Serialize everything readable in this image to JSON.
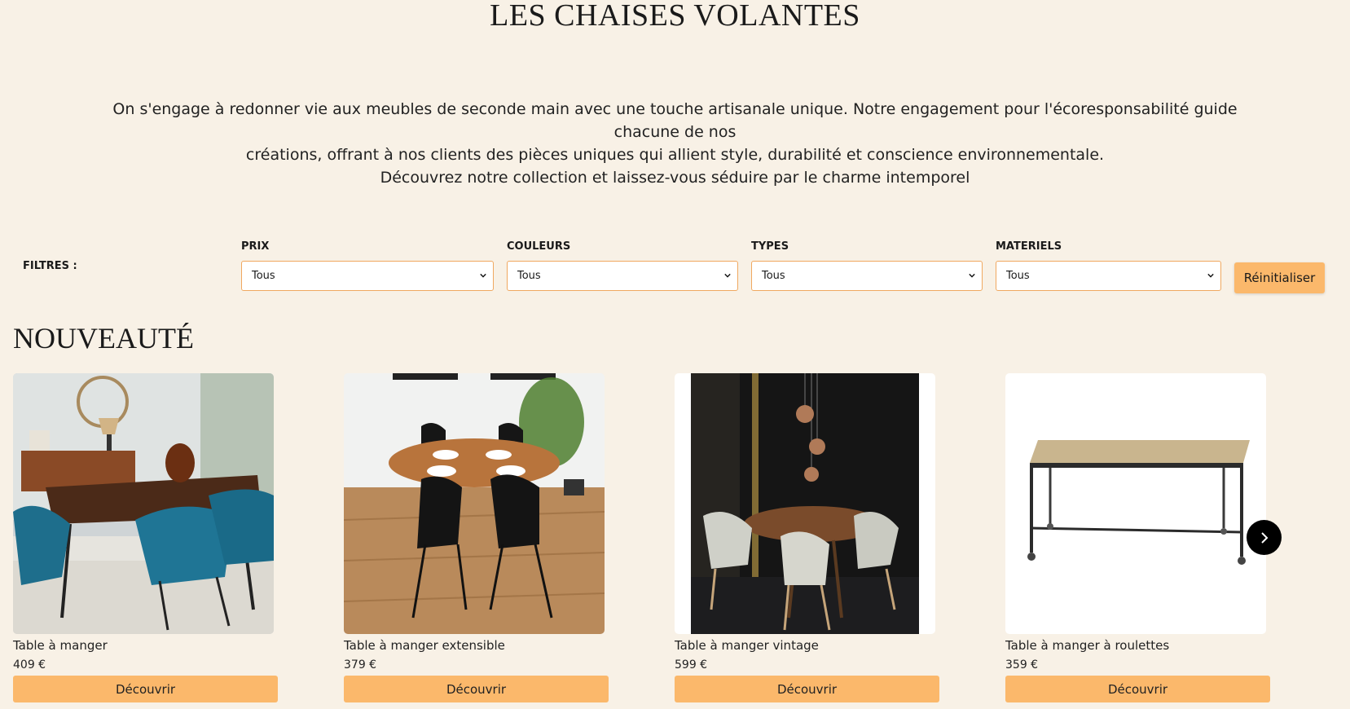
{
  "header": {
    "title": "LES CHAISES VOLANTES"
  },
  "intro": {
    "line1": "On s'engage à redonner vie aux meubles de seconde main avec une touche artisanale unique. Notre engagement pour l'écoresponsabilité guide chacune de nos",
    "line2": "créations, offrant à nos clients des pièces uniques qui allient style, durabilité et conscience environnementale.",
    "line3": "Découvrez notre collection et laissez-vous séduire par le charme intemporel"
  },
  "filters": {
    "label": "FILTRES :",
    "items": [
      {
        "label": "PRIX",
        "value": "Tous"
      },
      {
        "label": "COULEURS",
        "value": "Tous"
      },
      {
        "label": "TYPES",
        "value": "Tous"
      },
      {
        "label": "MATERIELS",
        "value": "Tous"
      }
    ],
    "reset_label": "Réinitialiser"
  },
  "section": {
    "title": "NOUVEAUTÉ"
  },
  "products": [
    {
      "name": "Table à manger",
      "price": "409 €",
      "button": "Découvrir"
    },
    {
      "name": "Table à manger extensible",
      "price": "379 €",
      "button": "Découvrir"
    },
    {
      "name": "Table à manger vintage",
      "price": "599 €",
      "button": "Découvrir"
    },
    {
      "name": "Table à manger à roulettes",
      "price": "359 €",
      "button": "Découvrir"
    }
  ],
  "colors": {
    "background": "#f8f1e6",
    "accent": "#fbb86b",
    "border": "#f0a860"
  },
  "icons": {
    "select": "chevron-down-icon",
    "carousel_next": "chevron-right-icon"
  }
}
